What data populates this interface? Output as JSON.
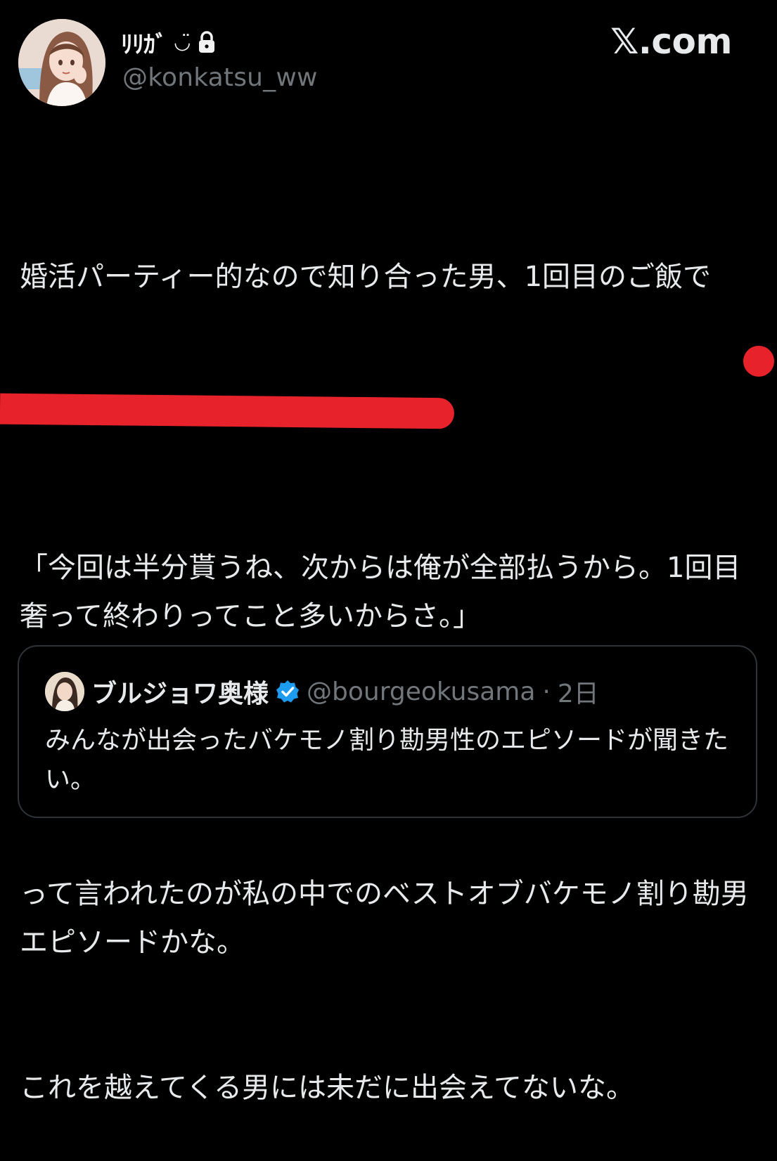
{
  "author": {
    "display_name": "ﾘﾘｶﾞ",
    "emoji": "◡̈",
    "avatar_icon": "avatar-illustration-icon",
    "lock_icon": "lock-icon",
    "handle": "@konkatsu_ww"
  },
  "brand": "𝕏.com",
  "tweet": {
    "line1": "婚活パーティー的なので知り合った男、1回目のご飯で",
    "line2": "「今回は半分貰うね、次からは俺が全部払うから。1回目奢って終わりってこと多いからさ。」",
    "line3": "って言われたのが私の中でのベストオブバケモノ割り勘男エピソードかな。",
    "line4": "これを越えてくる男には未だに出会えてないな。"
  },
  "quote": {
    "display_name": "ブルジョワ奥様",
    "verified_icon": "verified-badge-icon",
    "handle": "@bourgeokusama",
    "separator": "·",
    "time": "2日",
    "text": "みんなが出会ったバケモノ割り勘男性のエピソードが聞きたい。"
  },
  "colors": {
    "background": "#000000",
    "text": "#e7e9ea",
    "secondary": "#71767b",
    "highlight": "#e8222b",
    "verified": "#1d9bf0",
    "border": "#2f3336"
  }
}
